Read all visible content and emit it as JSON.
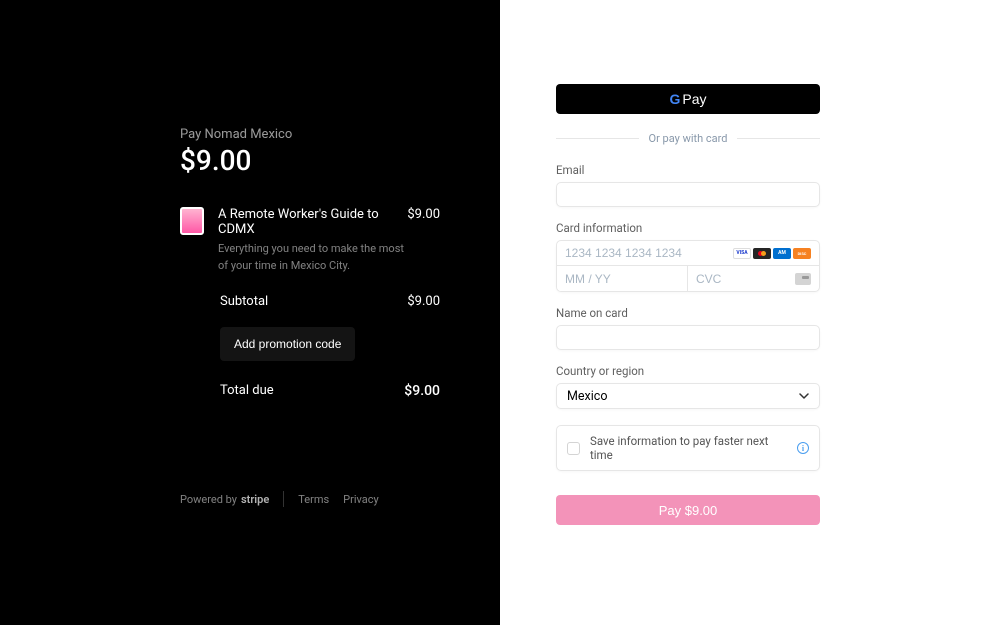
{
  "left": {
    "pay_merchant": "Pay Nomad Mexico",
    "amount": "$9.00",
    "product": {
      "title": "A Remote Worker's Guide to CDMX",
      "price": "$9.00",
      "description": "Everything you need to make the most of your time in Mexico City."
    },
    "subtotal_label": "Subtotal",
    "subtotal_amount": "$9.00",
    "promo_label": "Add promotion code",
    "total_label": "Total due",
    "total_amount": "$9.00",
    "footer": {
      "powered_by": "Powered by",
      "stripe": "stripe",
      "terms": "Terms",
      "privacy": "Privacy"
    }
  },
  "right": {
    "gpay_text": "Pay",
    "divider": "Or pay with card",
    "email_label": "Email",
    "card_label": "Card information",
    "card_number_placeholder": "1234 1234 1234 1234",
    "expiry_placeholder": "MM / YY",
    "cvc_placeholder": "CVC",
    "name_label": "Name on card",
    "country_label": "Country or region",
    "country_value": "Mexico",
    "save_info": "Save information to pay faster next time",
    "pay_button": "Pay $9.00"
  }
}
